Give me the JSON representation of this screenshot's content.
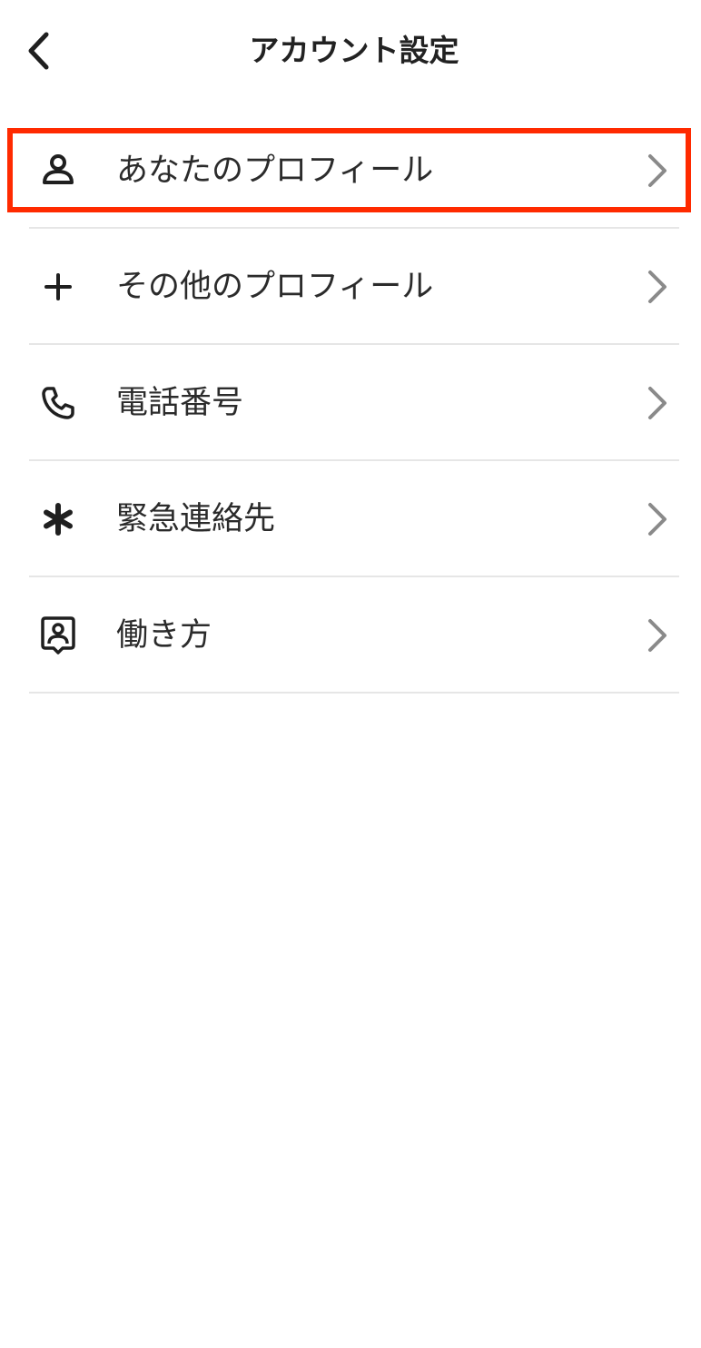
{
  "header": {
    "title": "アカウント設定",
    "back_icon": "chevron-left-icon"
  },
  "menu": {
    "items": [
      {
        "label": "あなたのプロフィール",
        "icon": "person-icon"
      },
      {
        "label": "その他のプロフィール",
        "icon": "plus-icon"
      },
      {
        "label": "電話番号",
        "icon": "phone-icon"
      },
      {
        "label": "緊急連絡先",
        "icon": "asterisk-icon"
      },
      {
        "label": "働き方",
        "icon": "badge-person-icon"
      }
    ]
  },
  "colors": {
    "highlight": "#ff2a00",
    "chevron": "#8a8a8a",
    "divider": "#e6e6e6",
    "text": "#2b2b2b"
  }
}
